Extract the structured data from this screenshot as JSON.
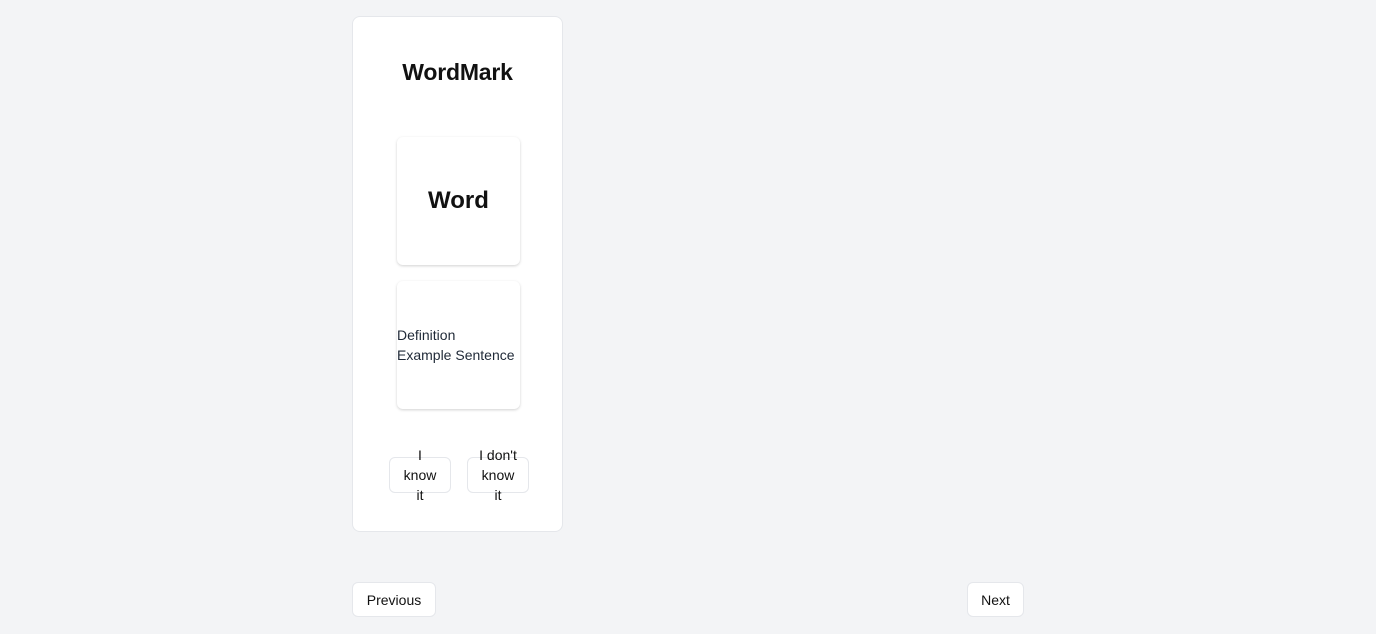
{
  "app": {
    "title": "WordMark"
  },
  "flashcard": {
    "word": "Word",
    "definition": "Definition",
    "example": "Example Sentence"
  },
  "answers": {
    "know_label": "I know it",
    "dont_know_label": "I don't know it"
  },
  "navigation": {
    "previous_label": "Previous",
    "next_label": "Next"
  },
  "colors": {
    "background": "#f3f4f6",
    "card": "#ffffff",
    "border": "#e5e7eb",
    "text": "#111111"
  }
}
